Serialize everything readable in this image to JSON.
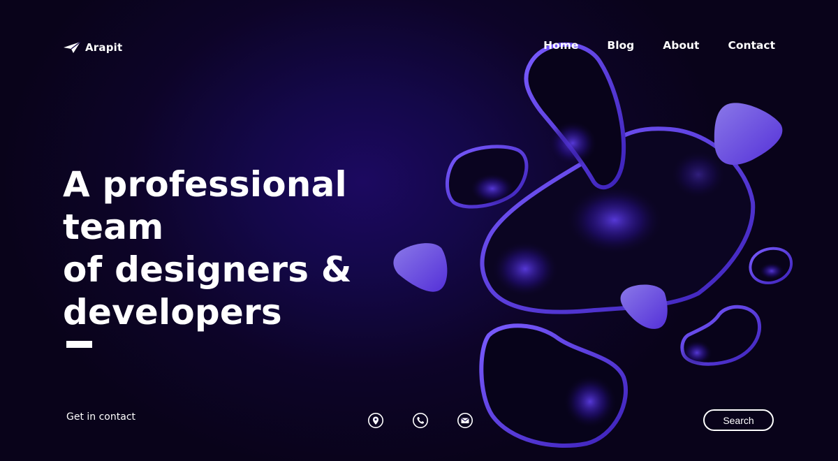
{
  "brand": {
    "name": "Arapit",
    "icon": "paper-plane-icon"
  },
  "nav": {
    "items": [
      {
        "label": "Home"
      },
      {
        "label": "Blog"
      },
      {
        "label": "About"
      },
      {
        "label": "Contact"
      }
    ]
  },
  "hero": {
    "lines": [
      "A professional team",
      "of designers &",
      "developers"
    ]
  },
  "footer": {
    "contact_label": "Get in contact",
    "icons": [
      "location-pin-icon",
      "phone-icon",
      "mail-icon"
    ],
    "search_label": "Search"
  },
  "colors": {
    "background": "#0b0418",
    "glow": "#1c0960",
    "accent": "#6a4fe0",
    "text": "#ffffff"
  }
}
